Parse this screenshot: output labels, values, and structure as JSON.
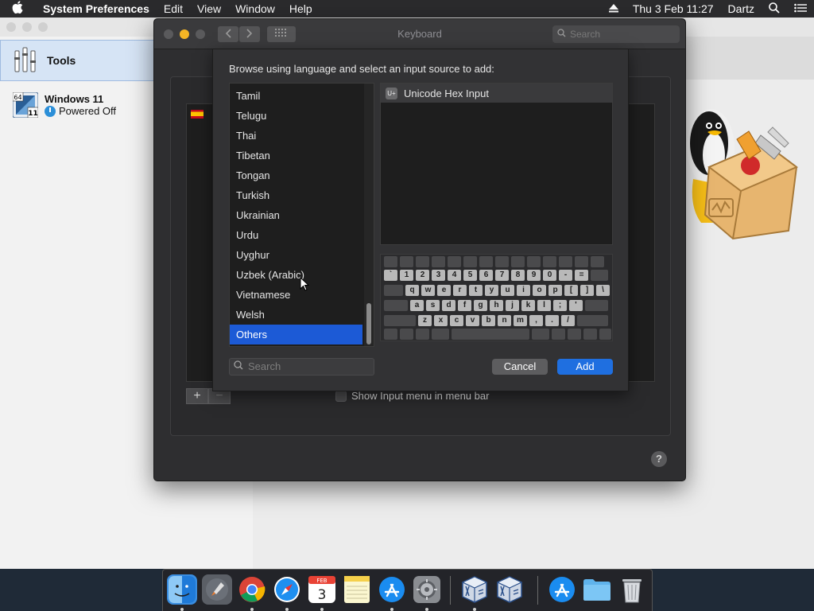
{
  "menubar": {
    "apple_icon": "apple-icon",
    "app_name": "System Preferences",
    "menus": [
      "Edit",
      "View",
      "Window",
      "Help"
    ],
    "datetime": "Thu 3 Feb  11:27",
    "user": "Dartz"
  },
  "vbox": {
    "tools_label": "Tools",
    "vm": {
      "name": "Windows 11",
      "state": "Powered Off",
      "badge_top": "64",
      "badge_bottom": "11"
    }
  },
  "keyboard_window": {
    "title": "Keyboard",
    "search_placeholder": "Search",
    "show_menu_label": "Show Input menu in menu bar",
    "help": "?"
  },
  "sheet": {
    "prompt": "Browse using language and select an input source to add:",
    "languages": [
      "Tamil",
      "Telugu",
      "Thai",
      "Tibetan",
      "Tongan",
      "Turkish",
      "Ukrainian",
      "Urdu",
      "Uyghur",
      "Uzbek (Arabic)",
      "Vietnamese",
      "Welsh",
      "Others"
    ],
    "selected_language": "Others",
    "input_sources": [
      {
        "icon": "U+",
        "label": "Unicode Hex Input"
      }
    ],
    "search_placeholder": "Search",
    "cancel_label": "Cancel",
    "add_label": "Add",
    "keyboard_rows": [
      [
        "`",
        "1",
        "2",
        "3",
        "4",
        "5",
        "6",
        "7",
        "8",
        "9",
        "0",
        "-",
        "="
      ],
      [
        "q",
        "w",
        "e",
        "r",
        "t",
        "y",
        "u",
        "i",
        "o",
        "p",
        "[",
        "]",
        "\\"
      ],
      [
        "a",
        "s",
        "d",
        "f",
        "g",
        "h",
        "j",
        "k",
        "l",
        ";",
        "'"
      ],
      [
        "z",
        "x",
        "c",
        "v",
        "b",
        "n",
        "m",
        ",",
        ".",
        "/"
      ]
    ]
  },
  "dock": {
    "apps": [
      "finder",
      "launchpad",
      "chrome",
      "safari",
      "calendar",
      "notes",
      "app-store",
      "system-preferences",
      "virtualbox",
      "virtualbox-vm"
    ],
    "calendar_month": "FEB",
    "calendar_day": "3",
    "extras": [
      "app-store-download",
      "folder",
      "trash"
    ]
  }
}
